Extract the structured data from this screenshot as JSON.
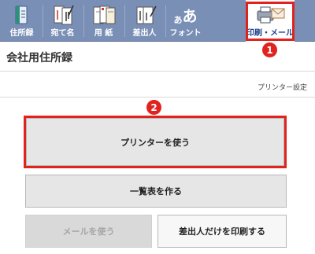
{
  "tabs": [
    {
      "label": "住所録",
      "icon": "address-book-icon"
    },
    {
      "label": "宛て名",
      "icon": "postcard-address-icon"
    },
    {
      "label": "用 紙",
      "icon": "paper-icon"
    },
    {
      "label": "差出人",
      "icon": "sender-icon"
    },
    {
      "label": "フォント",
      "icon": "font-icon",
      "glyph": "あ"
    },
    {
      "label": "印刷・メール",
      "icon": "print-mail-icon",
      "active": true
    }
  ],
  "header": {
    "title": "会社用住所録",
    "printer_settings_link": "プリンター設定"
  },
  "buttons": {
    "use_printer": "プリンターを使う",
    "create_list": "一覧表を作る",
    "use_mail": "メールを使う",
    "print_sender_only": "差出人だけを印刷する"
  },
  "callouts": {
    "badge1": "1",
    "badge2": "2"
  },
  "colors": {
    "tabbar": "#7a8fb6",
    "highlight": "#e0231f",
    "active_tab_text": "#1d3f8a"
  }
}
